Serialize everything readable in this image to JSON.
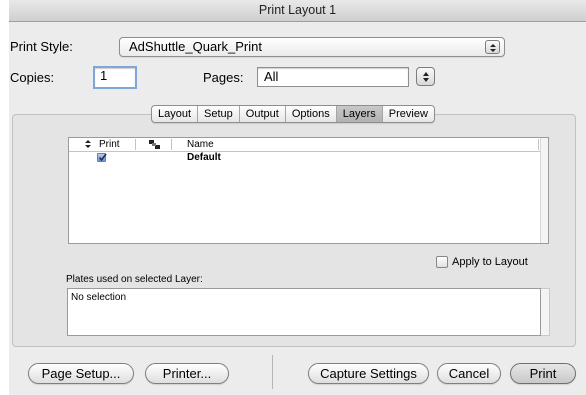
{
  "window": {
    "title": "Print Layout 1"
  },
  "print_style": {
    "label": "Print Style:",
    "value": "AdShuttle_Quark_Print"
  },
  "copies": {
    "label": "Copies:",
    "value": "1"
  },
  "pages": {
    "label": "Pages:",
    "value": "All"
  },
  "tabs": [
    {
      "label": "Layout",
      "active": false
    },
    {
      "label": "Setup",
      "active": false
    },
    {
      "label": "Output",
      "active": false
    },
    {
      "label": "Options",
      "active": false
    },
    {
      "label": "Layers",
      "active": true
    },
    {
      "label": "Preview",
      "active": false
    }
  ],
  "layers_table": {
    "columns": {
      "print": "Print",
      "name": "Name"
    },
    "rows": [
      {
        "print": true,
        "name": "Default"
      }
    ]
  },
  "apply_to_layout": {
    "label": "Apply to Layout",
    "checked": false
  },
  "plates": {
    "label": "Plates used on selected Layer:",
    "value": "No selection"
  },
  "buttons": {
    "page_setup": "Page Setup...",
    "printer": "Printer...",
    "capture_settings": "Capture Settings",
    "cancel": "Cancel",
    "print": "Print"
  },
  "colors": {
    "active_tab": "#b8b8b8",
    "checkbox_check": "#2a4f8f",
    "focus_ring": "#7ea6d9"
  }
}
